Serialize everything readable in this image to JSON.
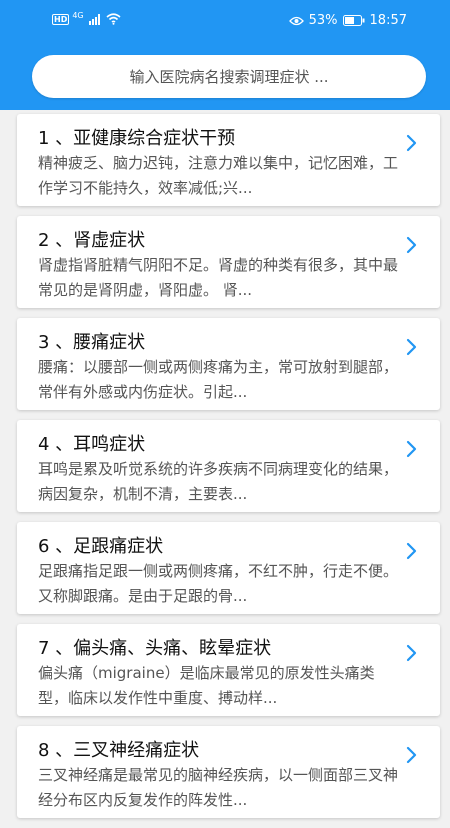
{
  "status_bar": {
    "hd_label": "HD",
    "network": "4G",
    "battery_percent": "53%",
    "time": "18:57"
  },
  "search": {
    "placeholder": "输入医院病名搜索调理症状 ..."
  },
  "items": [
    {
      "title": "1 、亚健康综合症状干预",
      "desc": "精神疲乏、脑力迟钝，注意力难以集中，记忆困难，工作学习不能持久，效率减低;兴..."
    },
    {
      "title": "2 、肾虚症状",
      "desc": "肾虚指肾脏精气阴阳不足。肾虚的种类有很多，其中最常见的是肾阴虚，肾阳虚。 肾..."
    },
    {
      "title": "3 、腰痛症状",
      "desc": "腰痛：以腰部一侧或两侧疼痛为主，常可放射到腿部，常伴有外感或内伤症状。引起..."
    },
    {
      "title": "4 、耳鸣症状",
      "desc": "耳鸣是累及听觉系统的许多疾病不同病理变化的结果，病因复杂，机制不清，主要表..."
    },
    {
      "title": "6 、足跟痛症状",
      "desc": "足跟痛指足跟一侧或两侧疼痛，不红不肿，行走不便。又称脚跟痛。是由于足跟的骨..."
    },
    {
      "title": "7 、偏头痛、头痛、眩晕症状",
      "desc": "偏头痛（migraine）是临床最常见的原发性头痛类型，临床以发作性中重度、搏动样..."
    },
    {
      "title": "8 、三叉神经痛症状",
      "desc": "三叉神经痛是最常见的脑神经疾病，以一侧面部三叉神经分布区内反复发作的阵发性..."
    }
  ],
  "colors": {
    "header": "#2196f3",
    "chevron": "#2196f3",
    "background": "#f1f1f1"
  }
}
